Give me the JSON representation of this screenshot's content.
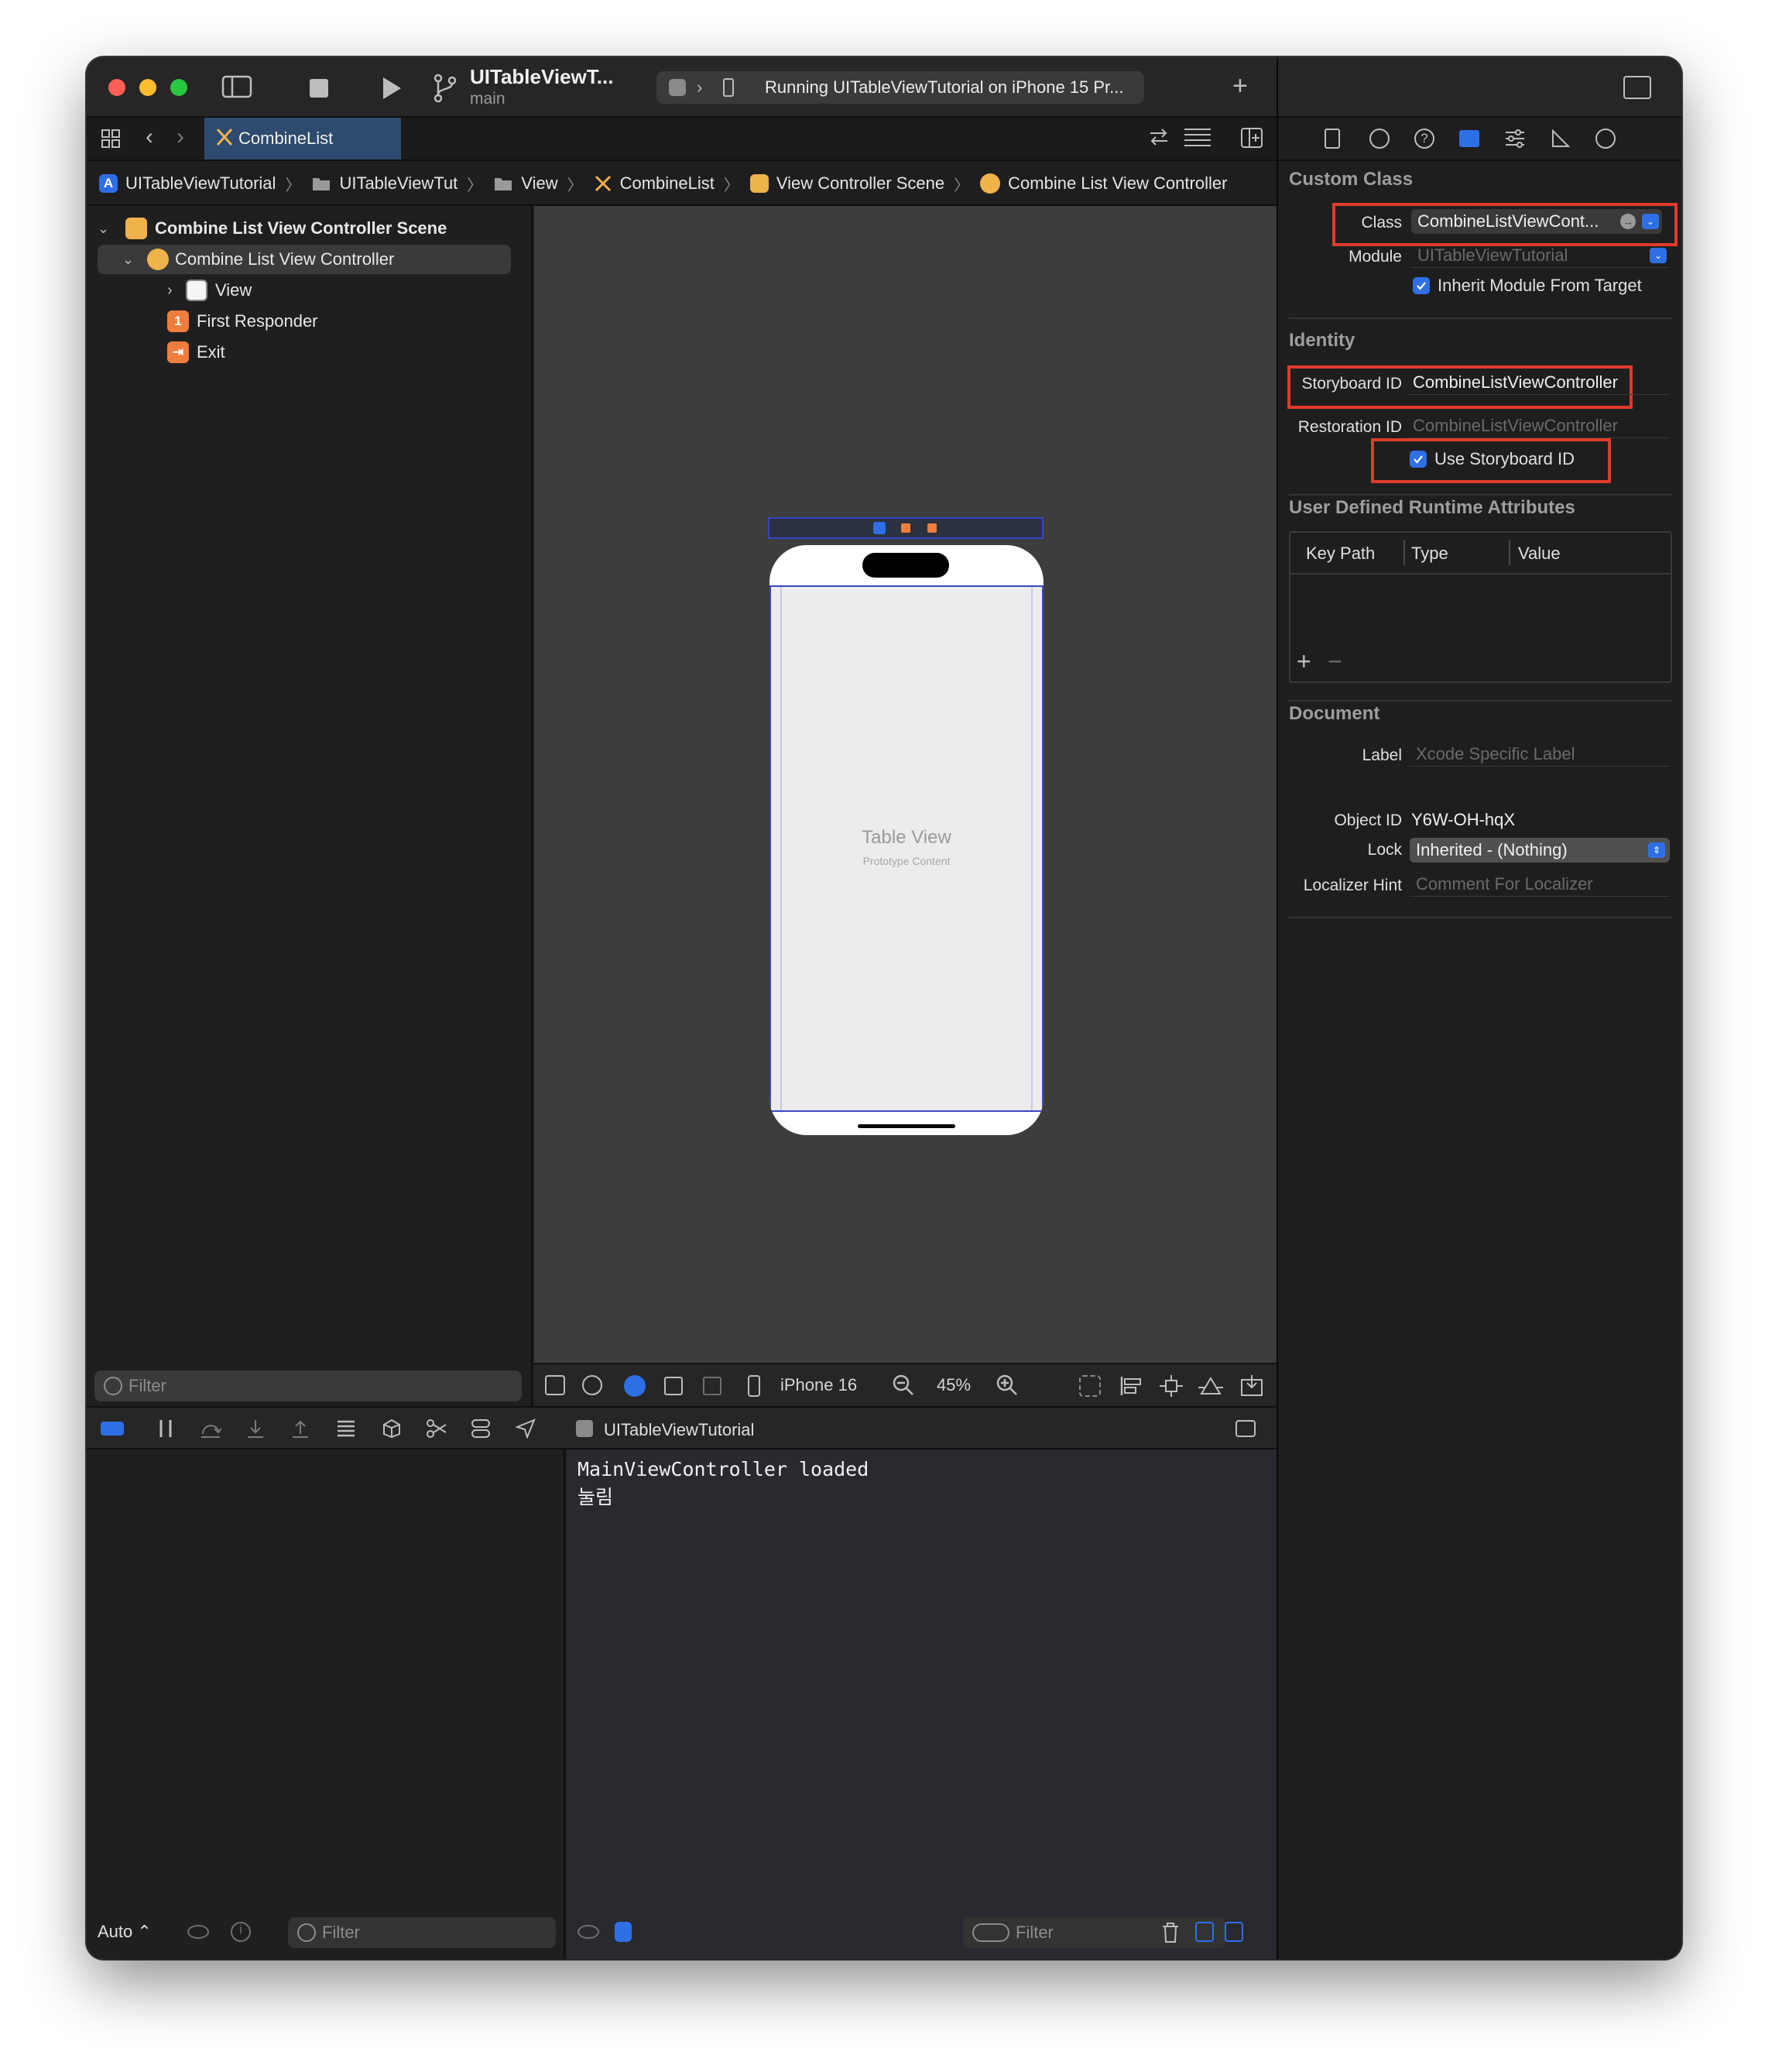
{
  "titlebar": {
    "scheme_title": "UITableViewT...",
    "branch": "main",
    "status": "Running UITableViewTutorial on iPhone 15 Pr..."
  },
  "tabs": [
    {
      "label": "CombineList"
    }
  ],
  "jumpbar": [
    "UITableViewTutorial",
    "UITableViewTut",
    "View",
    "CombineList",
    "View Controller Scene",
    "Combine List View Controller"
  ],
  "outline": {
    "scene": "Combine List View Controller Scene",
    "controller": "Combine List View Controller",
    "view": "View",
    "first_responder": "First Responder",
    "first_responder_badge": "1",
    "exit": "Exit"
  },
  "nav_filter_placeholder": "Filter",
  "canvas": {
    "table_title": "Table View",
    "table_subtitle": "Prototype Content"
  },
  "canvas_toolbar": {
    "device": "iPhone 16",
    "zoom": "45%"
  },
  "debug": {
    "target": "UITableViewTutorial"
  },
  "console": {
    "lines": [
      "MainViewController loaded",
      "눌림"
    ]
  },
  "bottom": {
    "auto": "Auto",
    "var_filter": "Filter",
    "console_filter": "Filter"
  },
  "inspector": {
    "custom_class": {
      "title": "Custom Class",
      "class_label": "Class",
      "class_value": "CombineListViewCont...",
      "module_label": "Module",
      "module_placeholder": "UITableViewTutorial",
      "inherit_label": "Inherit Module From Target",
      "inherit_checked": true
    },
    "identity": {
      "title": "Identity",
      "storyboard_id_label": "Storyboard ID",
      "storyboard_id_value": "CombineListViewController",
      "restoration_id_label": "Restoration ID",
      "restoration_id_placeholder": "CombineListViewController",
      "use_storyboard_label": "Use Storyboard ID",
      "use_storyboard_checked": true
    },
    "runtime_attrs": {
      "title": "User Defined Runtime Attributes",
      "columns": [
        "Key Path",
        "Type",
        "Value"
      ]
    },
    "document": {
      "title": "Document",
      "label_label": "Label",
      "label_placeholder": "Xcode Specific Label",
      "object_id_label": "Object ID",
      "object_id_value": "Y6W-OH-hqX",
      "lock_label": "Lock",
      "lock_value": "Inherited - (Nothing)",
      "localizer_label": "Localizer Hint",
      "localizer_placeholder": "Comment For Localizer",
      "label_colors": [
        "#f08a8a",
        "#f2bf6b",
        "#f2e36b",
        "#b6e07a",
        "#7ab8f2",
        "#c79af0",
        "#cfcfcf"
      ]
    }
  },
  "colors": {
    "accent": "#2f6fe6",
    "highlight": "#e03b2a",
    "tab_active": "#2e4a6e"
  }
}
